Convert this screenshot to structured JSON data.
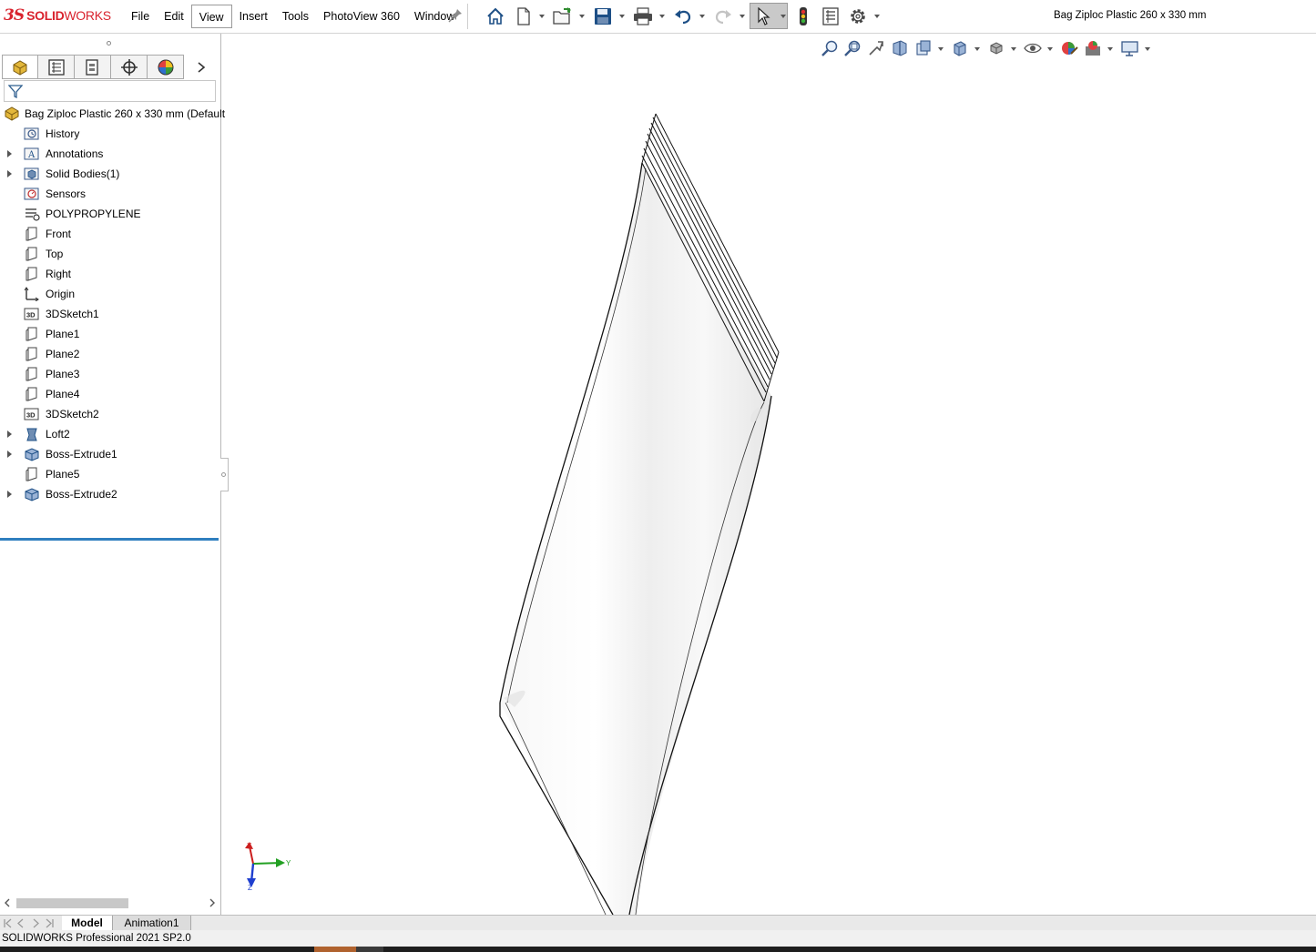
{
  "app": {
    "logo_prefix": "3S",
    "logo_text_bold": "SOLID",
    "logo_text_light": "WORKS"
  },
  "menu": {
    "items": [
      "File",
      "Edit",
      "View",
      "Insert",
      "Tools",
      "PhotoView 360",
      "Window"
    ],
    "active": "View"
  },
  "document": {
    "title": "Bag Ziploc Plastic 260 x 330 mm"
  },
  "feature_tree": {
    "root": "Bag Ziploc Plastic 260 x 330 mm  (Default",
    "items": [
      {
        "label": "History",
        "icon": "history-folder-icon",
        "expandable": false
      },
      {
        "label": "Annotations",
        "icon": "annotations-folder-icon",
        "expandable": true
      },
      {
        "label": "Solid Bodies(1)",
        "icon": "solid-bodies-folder-icon",
        "expandable": true
      },
      {
        "label": "Sensors",
        "icon": "sensors-folder-icon",
        "expandable": false
      },
      {
        "label": "POLYPROPYLENE",
        "icon": "material-icon",
        "expandable": false
      },
      {
        "label": "Front",
        "icon": "plane-icon",
        "expandable": false
      },
      {
        "label": "Top",
        "icon": "plane-icon",
        "expandable": false
      },
      {
        "label": "Right",
        "icon": "plane-icon",
        "expandable": false
      },
      {
        "label": "Origin",
        "icon": "origin-icon",
        "expandable": false
      },
      {
        "label": "3DSketch1",
        "icon": "3d-sketch-icon",
        "expandable": false
      },
      {
        "label": "Plane1",
        "icon": "plane-icon",
        "expandable": false
      },
      {
        "label": "Plane2",
        "icon": "plane-icon",
        "expandable": false
      },
      {
        "label": "Plane3",
        "icon": "plane-icon",
        "expandable": false
      },
      {
        "label": "Plane4",
        "icon": "plane-icon",
        "expandable": false
      },
      {
        "label": "3DSketch2",
        "icon": "3d-sketch-icon",
        "expandable": false
      },
      {
        "label": "Loft2",
        "icon": "loft-icon",
        "expandable": true
      },
      {
        "label": "Boss-Extrude1",
        "icon": "extrude-icon",
        "expandable": true
      },
      {
        "label": "Plane5",
        "icon": "plane-icon",
        "expandable": false
      },
      {
        "label": "Boss-Extrude2",
        "icon": "extrude-icon",
        "expandable": true
      }
    ]
  },
  "triad": {
    "x_label": "X",
    "y_label": "Y",
    "z_label": "Z"
  },
  "bottom_tabs": [
    "Model",
    "Animation1"
  ],
  "status": {
    "text": "SOLIDWORKS Professional 2021 SP2.0"
  }
}
